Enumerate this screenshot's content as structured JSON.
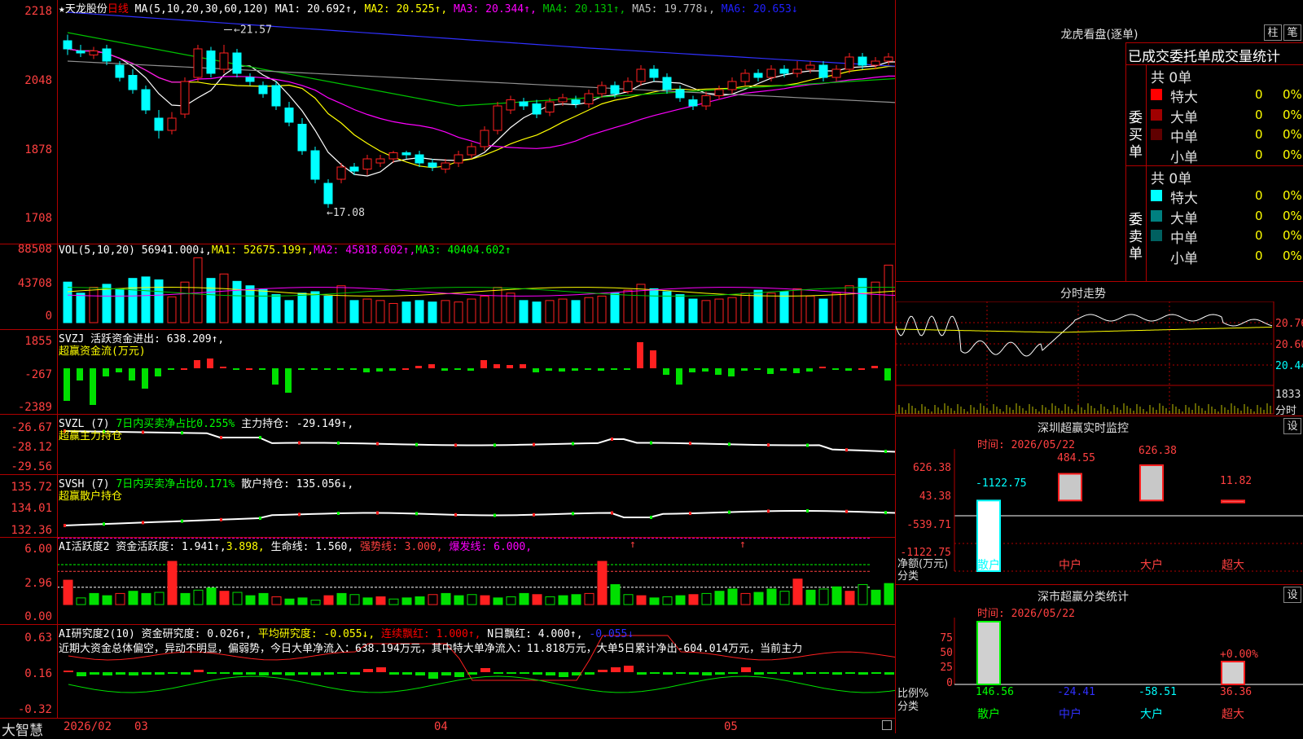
{
  "stock": {
    "name": "★天龙股份",
    "period": "日线"
  },
  "colors": {
    "up": "#ff2020",
    "down": "#00ffff",
    "ma1": "#ffffff",
    "ma2": "#ffff00",
    "ma3": "#ff00ff",
    "ma4": "#00c000",
    "ma5": "#808080",
    "ma6": "#2020ff",
    "grid": "#b00000"
  },
  "price_panel": {
    "ma_prefix": "MA(5,10,20,30,60,120)",
    "ma_values": [
      {
        "label": "MA1: 20.692↑,",
        "color": "#ffffff"
      },
      {
        "label": "MA2: 20.525↑,",
        "color": "#ffff00"
      },
      {
        "label": "MA3: 20.344↑,",
        "color": "#ff00ff"
      },
      {
        "label": "MA4: 20.131↑,",
        "color": "#00c000"
      },
      {
        "label": "MA5: 19.778↓,",
        "color": "#c0c0c0"
      },
      {
        "label": "MA6: 20.653↓",
        "color": "#2020ff"
      }
    ],
    "y_labels": [
      "2218",
      "2048",
      "1878",
      "1708"
    ],
    "high_marker": "21.57",
    "low_marker": "17.08"
  },
  "vol_panel": {
    "prefix": "VOL(5,10,20)",
    "value": "56941.000↓,",
    "ma1": "MA1: 52675.199↑,",
    "ma2": "MA2: 45818.602↑,",
    "ma3": "MA3: 40404.602↑",
    "y_labels": [
      "88508",
      "43708",
      "0"
    ]
  },
  "svzj_panel": {
    "prefix": "SVZJ",
    "label": "活跃资金进出: 638.209↑,",
    "sub": "超赢资金流(万元)",
    "y_labels": [
      "1855",
      "-267",
      "-2389"
    ]
  },
  "svzl_panel": {
    "prefix": "SVZL (7)",
    "ratio": "7日内买卖净占比0.255%",
    "label": "主力持仓: -29.149↑,",
    "sub": "超赢主力持仓",
    "y_labels": [
      "-26.67",
      "-28.12",
      "-29.56"
    ]
  },
  "svsh_panel": {
    "prefix": "SVSH (7)",
    "ratio": "7日内买卖净占比0.171%",
    "label": "散户持仓: 135.056↓,",
    "sub": "超赢散户持仓",
    "y_labels": [
      "135.72",
      "134.01",
      "132.36"
    ]
  },
  "ai_active": {
    "prefix": "AI活跃度2",
    "label1": "资金活跃度: 1.941↑,",
    "label2": "3.898,",
    "label3": "生命线: 1.560,",
    "label4": "强势线: 3.000,",
    "label5": "爆发线: 6.000,",
    "y_labels": [
      "6.00",
      "2.96",
      "0.00"
    ]
  },
  "ai_research": {
    "prefix": "AI研究度2(10)",
    "label1": "资金研究度: 0.026↑,",
    "label2": "平均研究度: -0.055↓,",
    "label3": "连续飘红: 1.000↑,",
    "label4": "N日飘红: 4.000↑,",
    "label5": "-0.055↓",
    "commentary": "近期大资金总体偏空，异动不明显，偏弱势，今日大单净流入：638.194万元，其中特大单净流入：11.818万元，大单5日累计净出-604.014万元，当前主力",
    "y_labels": [
      "0.63",
      "0.16",
      "-0.32"
    ]
  },
  "x_axis": {
    "brand": "大智慧",
    "dates": [
      "2026/02",
      "03",
      "04",
      "05"
    ]
  },
  "right": {
    "lh_title": "龙虎看盘(逐单)",
    "btn_zhu": "柱",
    "btn_bi": "笔",
    "lh_header": "已成交委托单成交量统计",
    "buy_label": "委买单",
    "sell_label": "委卖单",
    "buy_total": "共 0单",
    "sell_total": "共 0单",
    "buy_rows": [
      {
        "name": "特大",
        "count": "0",
        "pct": "0%",
        "color": "#ff0000"
      },
      {
        "name": "大单",
        "count": "0",
        "pct": "0%",
        "color": "#a00000"
      },
      {
        "name": "中单",
        "count": "0",
        "pct": "0%",
        "color": "#600000"
      },
      {
        "name": "小单",
        "count": "0",
        "pct": "0%",
        "color": "#000000"
      }
    ],
    "sell_rows": [
      {
        "name": "特大",
        "count": "0",
        "pct": "0%",
        "color": "#00ffff"
      },
      {
        "name": "大单",
        "count": "0",
        "pct": "0%",
        "color": "#008080"
      },
      {
        "name": "中单",
        "count": "0",
        "pct": "0%",
        "color": "#006060"
      },
      {
        "name": "小单",
        "count": "0",
        "pct": "0%",
        "color": "#000000"
      }
    ],
    "intraday_title": "分时走势",
    "intraday_prices": [
      "20.76",
      "20.60",
      "20.44"
    ],
    "intraday_vol": "1833",
    "intraday_vol_label": "分时",
    "monitor_title": "深圳超赢实时监控",
    "monitor_set": "设",
    "monitor_time": "时间: 2026/05/22",
    "monitor_y": [
      "626.38",
      "43.38",
      "-539.71",
      "-1122.75"
    ],
    "monitor_unit": "净额(万元)",
    "monitor_cat_label": "分类",
    "monitor_values": [
      {
        "cat": "散户",
        "value": "-1122.75"
      },
      {
        "cat": "中户",
        "value": "484.55"
      },
      {
        "cat": "大户",
        "value": "626.38"
      },
      {
        "cat": "超大",
        "value": "11.82"
      }
    ],
    "stats_title": "深市超赢分类统计",
    "stats_set": "设",
    "stats_time": "时间: 2026/05/22",
    "stats_y": [
      "75",
      "50",
      "25",
      "0"
    ],
    "stats_unit": "比例%",
    "stats_cat_label": "分类",
    "stats_pct_label": "+0.00%",
    "stats_values": [
      {
        "cat": "散户",
        "value": "146.56"
      },
      {
        "cat": "中户",
        "value": "-24.41"
      },
      {
        "cat": "大户",
        "value": "-58.51"
      },
      {
        "cat": "超大",
        "value": "36.36"
      }
    ]
  },
  "chart_data": [
    {
      "type": "candlestick",
      "title": "日线",
      "ylim": [
        1690,
        2230
      ],
      "ohlc": [
        [
          2130,
          2110,
          2145,
          2095
        ],
        [
          2105,
          2100,
          2120,
          2090
        ],
        [
          2095,
          2105,
          2115,
          2085
        ],
        [
          2110,
          2080,
          2120,
          2070
        ],
        [
          2070,
          2040,
          2080,
          2030
        ],
        [
          2045,
          2010,
          2060,
          2000
        ],
        [
          2010,
          1960,
          2020,
          1950
        ],
        [
          1940,
          1910,
          1960,
          1890
        ],
        [
          1910,
          1940,
          1955,
          1900
        ],
        [
          1950,
          2030,
          2040,
          1940
        ],
        [
          2040,
          2110,
          2120,
          2030
        ],
        [
          2105,
          2050,
          2115,
          2040
        ],
        [
          2060,
          2100,
          2120,
          2050
        ],
        [
          2100,
          2050,
          2110,
          2040
        ],
        [
          2040,
          2030,
          2050,
          2020
        ],
        [
          2020,
          2000,
          2030,
          1990
        ],
        [
          2020,
          1970,
          2030,
          1960
        ],
        [
          1965,
          1930,
          1980,
          1920
        ],
        [
          1925,
          1860,
          1940,
          1850
        ],
        [
          1860,
          1790,
          1870,
          1780
        ],
        [
          1780,
          1730,
          1790,
          1720
        ],
        [
          1790,
          1820,
          1830,
          1780
        ],
        [
          1820,
          1810,
          1830,
          1800
        ],
        [
          1815,
          1840,
          1850,
          1800
        ],
        [
          1830,
          1840,
          1850,
          1820
        ],
        [
          1840,
          1855,
          1860,
          1830
        ],
        [
          1855,
          1850,
          1860,
          1840
        ],
        [
          1850,
          1830,
          1860,
          1820
        ],
        [
          1830,
          1820,
          1840,
          1810
        ],
        [
          1815,
          1830,
          1840,
          1805
        ],
        [
          1830,
          1850,
          1860,
          1820
        ],
        [
          1850,
          1870,
          1880,
          1840
        ],
        [
          1870,
          1910,
          1920,
          1860
        ],
        [
          1910,
          1970,
          1980,
          1900
        ],
        [
          1960,
          1985,
          1995,
          1950
        ],
        [
          1980,
          1970,
          1990,
          1960
        ],
        [
          1975,
          1950,
          1985,
          1940
        ],
        [
          1955,
          1980,
          1990,
          1945
        ],
        [
          1980,
          1990,
          2000,
          1970
        ],
        [
          1985,
          1975,
          1995,
          1965
        ],
        [
          1975,
          2000,
          2010,
          1965
        ],
        [
          2000,
          2020,
          2030,
          1990
        ],
        [
          2020,
          2000,
          2030,
          1990
        ],
        [
          2005,
          2030,
          2040,
          2000
        ],
        [
          2030,
          2060,
          2070,
          2020
        ],
        [
          2060,
          2040,
          2070,
          2030
        ],
        [
          2040,
          2010,
          2050,
          2000
        ],
        [
          2010,
          1990,
          2020,
          1980
        ],
        [
          1985,
          1970,
          1995,
          1960
        ],
        [
          1970,
          1995,
          2005,
          1960
        ],
        [
          1995,
          2010,
          2020,
          1985
        ],
        [
          2010,
          2030,
          2040,
          2000
        ],
        [
          2030,
          2050,
          2060,
          2020
        ],
        [
          2050,
          2040,
          2060,
          2030
        ],
        [
          2040,
          2060,
          2070,
          2030
        ],
        [
          2060,
          2050,
          2070,
          2040
        ],
        [
          2050,
          2060,
          2080,
          2040
        ],
        [
          2060,
          2070,
          2080,
          2050
        ],
        [
          2070,
          2040,
          2080,
          2030
        ],
        [
          2040,
          2060,
          2070,
          2030
        ],
        [
          2060,
          2090,
          2100,
          2050
        ],
        [
          2090,
          2070,
          2100,
          2060
        ],
        [
          2070,
          2080,
          2090,
          2060
        ],
        [
          2080,
          2090,
          2100,
          2070
        ],
        [
          2090,
          2060,
          2100,
          2050
        ]
      ]
    }
  ]
}
